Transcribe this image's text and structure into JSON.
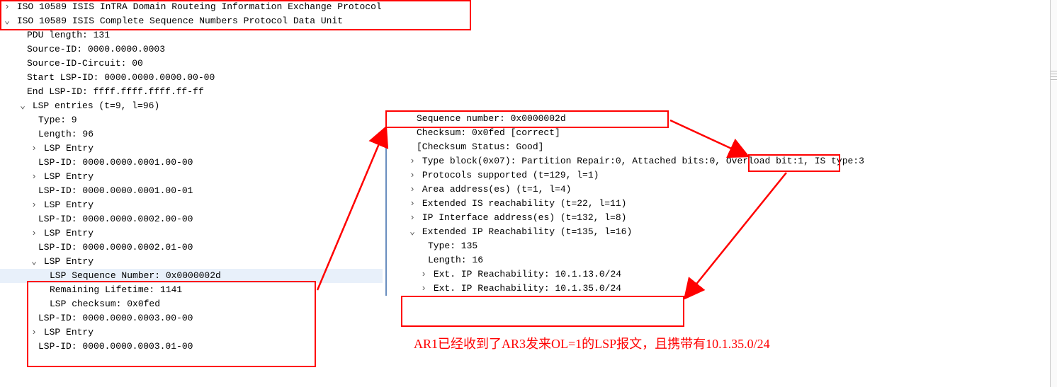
{
  "header": {
    "line1": "ISO 10589 ISIS InTRA Domain Routeing Information Exchange Protocol",
    "line2": "ISO 10589 ISIS Complete Sequence Numbers Protocol Data Unit"
  },
  "csnp": {
    "pdu_length": "PDU length: 131",
    "source_id": "Source-ID: 0000.0000.0003",
    "source_id_circuit": "Source-ID-Circuit: 00",
    "start_lsp": "Start LSP-ID: 0000.0000.0000.00-00",
    "end_lsp": "End LSP-ID: ffff.ffff.ffff.ff-ff",
    "entries_hdr": "LSP entries (t=9, l=96)",
    "type": "Type: 9",
    "length": "Length: 96",
    "lsp_entry_label": "LSP Entry",
    "e1": "LSP-ID: 0000.0000.0001.00-00",
    "e2": "LSP-ID: 0000.0000.0001.00-01",
    "e3": "LSP-ID: 0000.0000.0002.00-00",
    "e4": "LSP-ID: 0000.0000.0002.01-00",
    "open_seq": "LSP Sequence Number: 0x0000002d",
    "open_life": "Remaining Lifetime: 1141",
    "open_chk": "LSP checksum: 0x0fed",
    "e5": "LSP-ID: 0000.0000.0003.00-00",
    "e6": "LSP-ID: 0000.0000.0003.01-00"
  },
  "right": {
    "seq": "Sequence number: 0x0000002d",
    "chk": "Checksum: 0x0fed [correct]",
    "chkstat": "[Checksum Status: Good]",
    "typeblock": "Type block(0x07): Partition Repair:0, Attached bits:0, Overload bit:1, IS type:3",
    "protos": "Protocols supported (t=129, l=1)",
    "area": "Area address(es) (t=1, l=4)",
    "extis": "Extended IS reachability (t=22, l=11)",
    "ipif": "IP Interface address(es) (t=132, l=8)",
    "extip_hdr": "Extended IP Reachability (t=135, l=16)",
    "extip_type": "Type: 135",
    "extip_len": "Length: 16",
    "reach1": "Ext. IP Reachability: 10.1.13.0/24",
    "reach2": "Ext. IP Reachability: 10.1.35.0/24"
  },
  "annotation": "AR1已经收到了AR3发来OL=1的LSP报文，且携带有10.1.35.0/24"
}
